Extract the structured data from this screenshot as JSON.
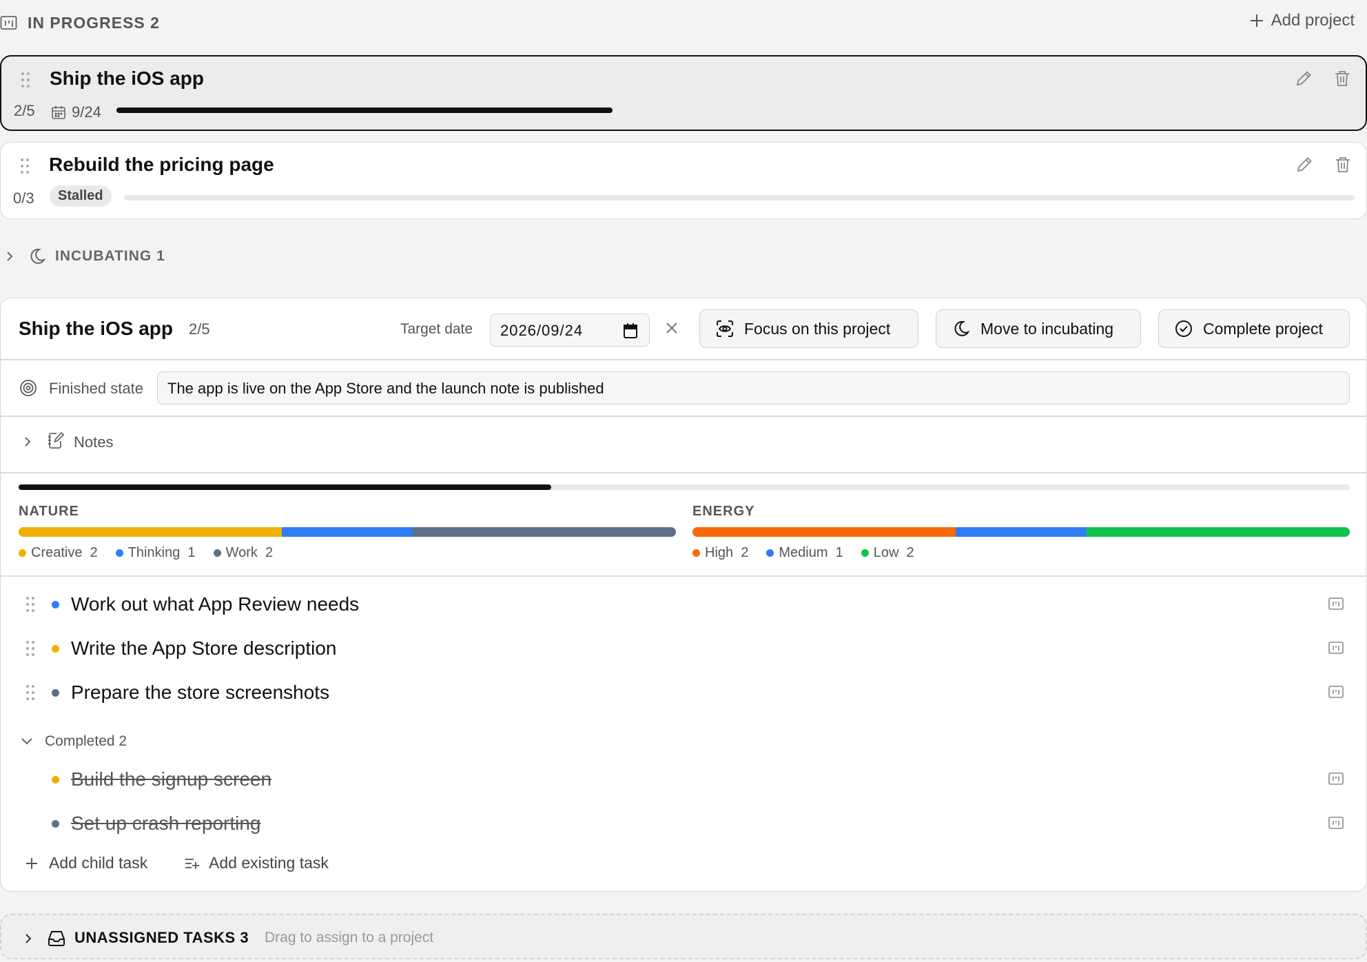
{
  "in_progress": {
    "title": "IN PROGRESS 2",
    "add_project": "Add project"
  },
  "projects": [
    {
      "name": "Ship the iOS app",
      "count": "2/5",
      "due": "9/24",
      "progress": 0.4,
      "active": true
    },
    {
      "name": "Rebuild the pricing page",
      "count": "0/3",
      "badge": "Stalled",
      "progress": 0.0
    }
  ],
  "incubating": {
    "label": "INCUBATING 1"
  },
  "detail": {
    "title": "Ship the iOS app",
    "count": "2/5",
    "target_label": "Target date",
    "target_value": "2026/09/24",
    "buttons": {
      "focus": "Focus on this project",
      "incubate": "Move to incubating",
      "complete": "Complete project"
    },
    "finished_label": "Finished state",
    "finished_value": "The app is live on the App Store and the launch note is published",
    "notes_label": "Notes",
    "progress": 0.4,
    "nature": {
      "title": "NATURE",
      "items": [
        {
          "label": "Creative",
          "count": "2",
          "value": 2,
          "color": "#f0b000"
        },
        {
          "label": "Thinking",
          "count": "1",
          "value": 1,
          "color": "#2f7cf6"
        },
        {
          "label": "Work",
          "count": "2",
          "value": 2,
          "color": "#5e7087"
        }
      ]
    },
    "energy": {
      "title": "ENERGY",
      "items": [
        {
          "label": "High",
          "count": "2",
          "value": 2,
          "color": "#fb6a0a"
        },
        {
          "label": "Medium",
          "count": "1",
          "value": 1,
          "color": "#2f7cf6"
        },
        {
          "label": "Low",
          "count": "2",
          "value": 2,
          "color": "#10c24c"
        }
      ]
    },
    "tasks": [
      {
        "text": "Work out what App Review needs",
        "color": "#2f7cf6"
      },
      {
        "text": "Write the App Store description",
        "color": "#f0b000"
      },
      {
        "text": "Prepare the store screenshots",
        "color": "#5e7087"
      }
    ],
    "completed_label": "Completed 2",
    "completed_tasks": [
      {
        "text": "Build the signup screen",
        "color": "#f0b000"
      },
      {
        "text": "Set up crash reporting",
        "color": "#5e7087"
      }
    ],
    "add_child": "Add child task",
    "add_existing": "Add existing task"
  },
  "unassigned": {
    "title": "UNASSIGNED TASKS 3",
    "hint": "Drag to assign to a project"
  }
}
